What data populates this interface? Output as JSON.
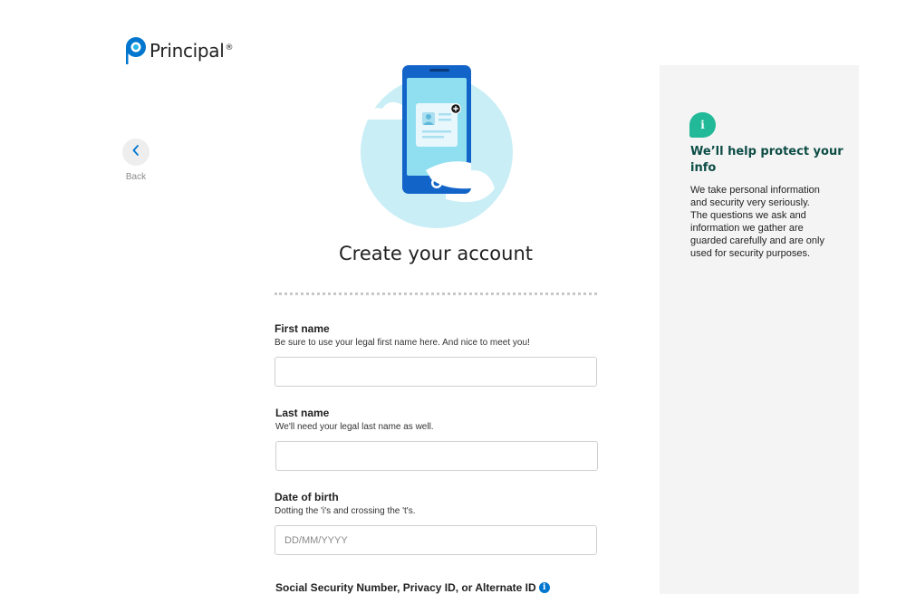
{
  "brand": {
    "name": "Principal",
    "reg_mark": "®",
    "colors": {
      "blue": "#0076cf",
      "teal": "#21b998",
      "dark_teal": "#0d4d46"
    }
  },
  "nav": {
    "back_label": "Back",
    "back_icon": "chevron-left-icon"
  },
  "hero": {
    "illustration": "phone-id-card-illustration"
  },
  "page": {
    "title": "Create your account"
  },
  "form": {
    "first_name": {
      "label": "First name",
      "help": "Be sure to use your legal first name here. And nice to meet you!",
      "value": "",
      "placeholder": ""
    },
    "last_name": {
      "label": "Last name",
      "help": "We'll need your legal last name as well.",
      "value": "",
      "placeholder": ""
    },
    "dob": {
      "label": "Date of birth",
      "help": "Dotting the 'i's and crossing the 't's.",
      "value": "",
      "placeholder": "DD/MM/YYYY"
    },
    "ssn": {
      "label": "Social Security Number, Privacy ID, or Alternate ID",
      "info_icon": "info-icon",
      "info_glyph": "i"
    }
  },
  "side_panel": {
    "icon": "info-bubble-icon",
    "icon_glyph": "i",
    "title": "We’ll help protect your info",
    "body": "We take personal information and security very seriously. The questions we ask and information we gather are guarded carefully and are only used for security purposes."
  }
}
